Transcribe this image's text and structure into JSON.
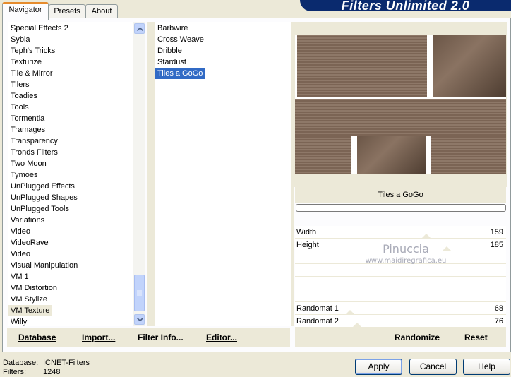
{
  "tabs": [
    {
      "label": "Navigator"
    },
    {
      "label": "Presets"
    },
    {
      "label": "About"
    }
  ],
  "banner_title": "Filters Unlimited 2.0",
  "categories": [
    "Special Effects 2",
    "Sybia",
    "Teph's Tricks",
    "Texturize",
    "Tile & Mirror",
    "Tilers",
    "Toadies",
    "Tools",
    "Tormentia",
    "Tramages",
    "Transparency",
    "Tronds Filters",
    "Two Moon",
    "Tymoes",
    "UnPlugged Effects",
    "UnPlugged Shapes",
    "UnPlugged Tools",
    "Variations",
    "Video",
    "VideoRave",
    "Video",
    "Visual Manipulation",
    "VM 1",
    "VM Distortion",
    "VM Stylize",
    "VM Texture",
    "Willy"
  ],
  "selected_category": "VM Texture",
  "filters": [
    "Barbwire",
    "Cross Weave",
    "Dribble",
    "Stardust",
    "Tiles a GoGo"
  ],
  "selected_filter": "Tiles a GoGo",
  "preview_filter_name": "Tiles a GoGo",
  "params": {
    "width": {
      "label": "Width",
      "value": "159"
    },
    "height": {
      "label": "Height",
      "value": "185"
    },
    "randomat1": {
      "label": "Randomat 1",
      "value": "68"
    },
    "randomat2": {
      "label": "Randomat 2",
      "value": "76"
    }
  },
  "watermark": {
    "line1": "Pinuccia",
    "line2": "www.maidiregrafica.eu"
  },
  "bottom_buttons": {
    "database": "Database",
    "import": "Import...",
    "filter_info": "Filter Info...",
    "editor": "Editor...",
    "randomize": "Randomize",
    "reset": "Reset"
  },
  "status": {
    "database_label": "Database:",
    "database_value": "ICNET-Filters",
    "filters_label": "Filters:",
    "filters_value": "1248"
  },
  "dialog_buttons": {
    "apply": "Apply",
    "cancel": "Cancel",
    "help": "Help"
  },
  "colors": {
    "accent_tab": "#e68b2c",
    "selection": "#316ac5",
    "banner": "#0a2a6e"
  }
}
